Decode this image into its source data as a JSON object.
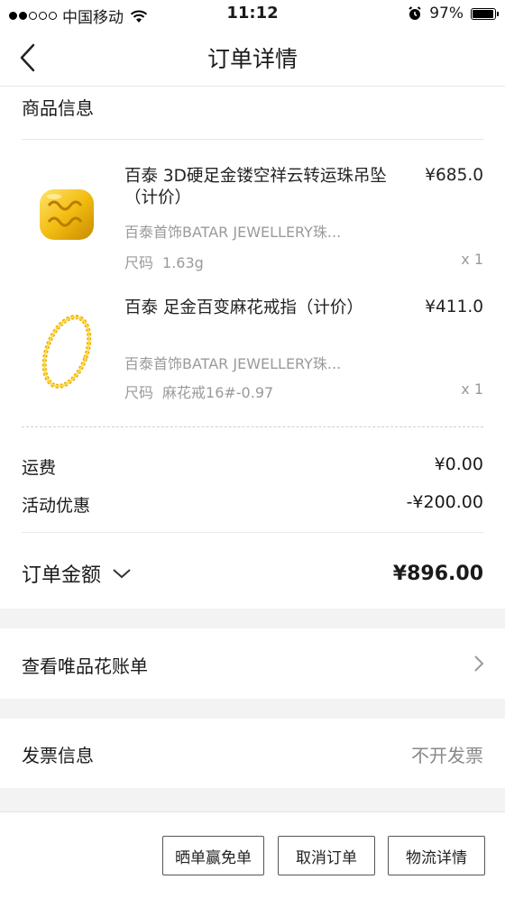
{
  "status_bar": {
    "carrier": "中国移动",
    "time": "11:12",
    "battery": "97%",
    "battery_level": 0.97
  },
  "nav": {
    "title": "订单详情"
  },
  "goods_section": {
    "title": "商品信息"
  },
  "products": [
    {
      "name": "百泰 3D硬足金镂空祥云转运珠吊坠（计价）",
      "price": "¥685.0",
      "brand": "百泰首饰BATAR JEWELLERY珠...",
      "spec_label": "尺码",
      "spec_value": "1.63g",
      "qty": "x 1",
      "thumb_icon": "gold-bead-icon"
    },
    {
      "name": "百泰 足金百变麻花戒指（计价）",
      "price": "¥411.0",
      "brand": "百泰首饰BATAR JEWELLERY珠...",
      "spec_label": "尺码",
      "spec_value": "麻花戒16#-0.97",
      "qty": "x 1",
      "thumb_icon": "gold-ring-icon"
    }
  ],
  "fees": {
    "shipping_label": "运费",
    "shipping_value": "¥0.00",
    "discount_label": "活动优惠",
    "discount_value": "-¥200.00"
  },
  "total": {
    "label": "订单金额",
    "value": "¥896.00"
  },
  "bill_link": {
    "label": "查看唯品花账单"
  },
  "invoice": {
    "label": "发票信息",
    "value": "不开发票"
  },
  "actions": {
    "share": "晒单赢免单",
    "cancel": "取消订单",
    "logistics": "物流详情"
  }
}
